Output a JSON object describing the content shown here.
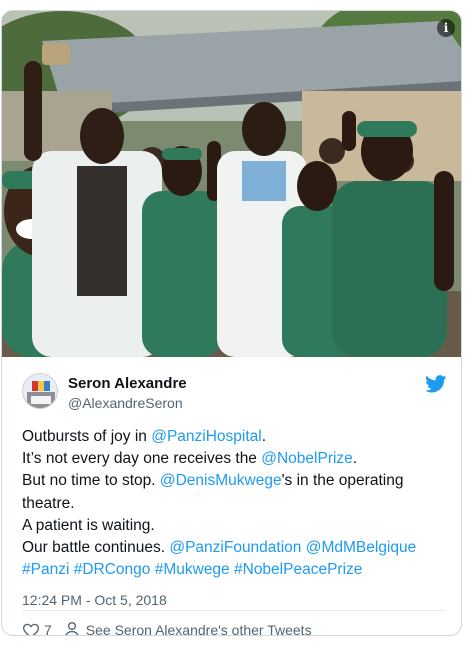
{
  "photo": {
    "description_icon": "i"
  },
  "author": {
    "name": "Seron Alexandre",
    "handle": "@AlexandreSeron"
  },
  "tweet": {
    "lines": [
      {
        "parts": [
          {
            "t": "Outbursts of joy in ",
            "link": false
          },
          {
            "t": "@PanziHospital",
            "link": true
          },
          {
            "t": ".",
            "link": false
          }
        ]
      },
      {
        "parts": [
          {
            "t": "It’s not every day one receives the ",
            "link": false
          },
          {
            "t": "@NobelPrize",
            "link": true
          },
          {
            "t": ".",
            "link": false
          }
        ]
      },
      {
        "parts": [
          {
            "t": "But no time to stop. ",
            "link": false
          },
          {
            "t": "@DenisMukwege",
            "link": true
          },
          {
            "t": "'s in the operating",
            "link": false
          }
        ]
      },
      {
        "parts": [
          {
            "t": "theatre.",
            "link": false
          }
        ]
      },
      {
        "parts": [
          {
            "t": "A patient is waiting.",
            "link": false
          }
        ]
      },
      {
        "parts": [
          {
            "t": "Our battle continues. ",
            "link": false
          },
          {
            "t": "@PanziFoundation",
            "link": true
          },
          {
            "t": " ",
            "link": false
          },
          {
            "t": "@MdMBelgique",
            "link": true
          }
        ]
      },
      {
        "parts": [
          {
            "t": "#Panzi",
            "link": true
          },
          {
            "t": " ",
            "link": false
          },
          {
            "t": "#DRCongo",
            "link": true
          },
          {
            "t": " ",
            "link": false
          },
          {
            "t": "#Mukwege",
            "link": true
          },
          {
            "t": " ",
            "link": false
          },
          {
            "t": "#NobelPeacePrize",
            "link": true
          }
        ]
      }
    ],
    "timestamp": "12:24 PM - Oct 5, 2018"
  },
  "actions": {
    "like_count": "7",
    "other_tweets_label": "See Seron Alexandre's other Tweets"
  },
  "colors": {
    "link": "#1d9bf0",
    "twitter_blue": "#1d9bf0",
    "secondary_text": "#536471",
    "scrubs_green": "#2f7a5a"
  },
  "icons": {
    "info": "info-icon",
    "twitter": "twitter-bird-icon",
    "like": "heart-icon",
    "profile": "person-icon"
  }
}
